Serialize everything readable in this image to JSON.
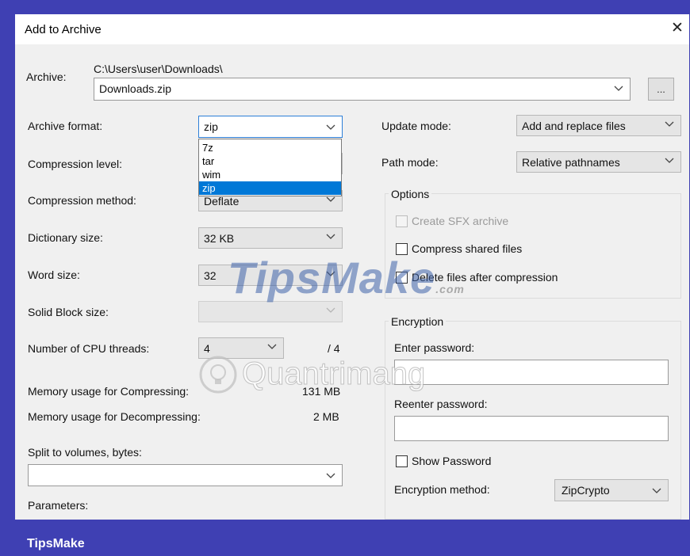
{
  "window": {
    "title": "Add to Archive",
    "close": "✕"
  },
  "archive": {
    "label": "Archive:",
    "path": "C:\\Users\\user\\Downloads\\",
    "filename": "Downloads.zip",
    "browse_label": "..."
  },
  "left": {
    "archive_format": {
      "label": "Archive format:",
      "value": "zip",
      "options": [
        "7z",
        "tar",
        "wim",
        "zip"
      ]
    },
    "compression_level": {
      "label": "Compression level:"
    },
    "compression_method": {
      "label": "Compression method:",
      "value": "Deflate"
    },
    "dictionary_size": {
      "label": "Dictionary size:",
      "value": "32 KB"
    },
    "word_size": {
      "label": "Word size:",
      "value": "32"
    },
    "solid_block_size": {
      "label": "Solid Block size:"
    },
    "cpu_threads": {
      "label": "Number of CPU threads:",
      "value": "4",
      "max": "/ 4"
    },
    "mem_compress": {
      "label": "Memory usage for Compressing:",
      "value": "131 MB"
    },
    "mem_decompress": {
      "label": "Memory usage for Decompressing:",
      "value": "2 MB"
    },
    "split": {
      "label": "Split to volumes, bytes:"
    },
    "parameters": {
      "label": "Parameters:"
    }
  },
  "right": {
    "update_mode": {
      "label": "Update mode:",
      "value": "Add and replace files"
    },
    "path_mode": {
      "label": "Path mode:",
      "value": "Relative pathnames"
    },
    "options": {
      "title": "Options",
      "create_sfx": "Create SFX archive",
      "compress_shared": "Compress shared files",
      "delete_after": "Delete files after compression"
    },
    "encryption": {
      "title": "Encryption",
      "enter_password": "Enter password:",
      "reenter_password": "Reenter password:",
      "show_password": "Show Password",
      "method_label": "Encryption method:",
      "method_value": "ZipCrypto"
    }
  },
  "watermark": {
    "brand": "TipsMake",
    "domain": ".com",
    "site": "Quantrimang"
  },
  "footer": {
    "brand": "TipsMake"
  }
}
